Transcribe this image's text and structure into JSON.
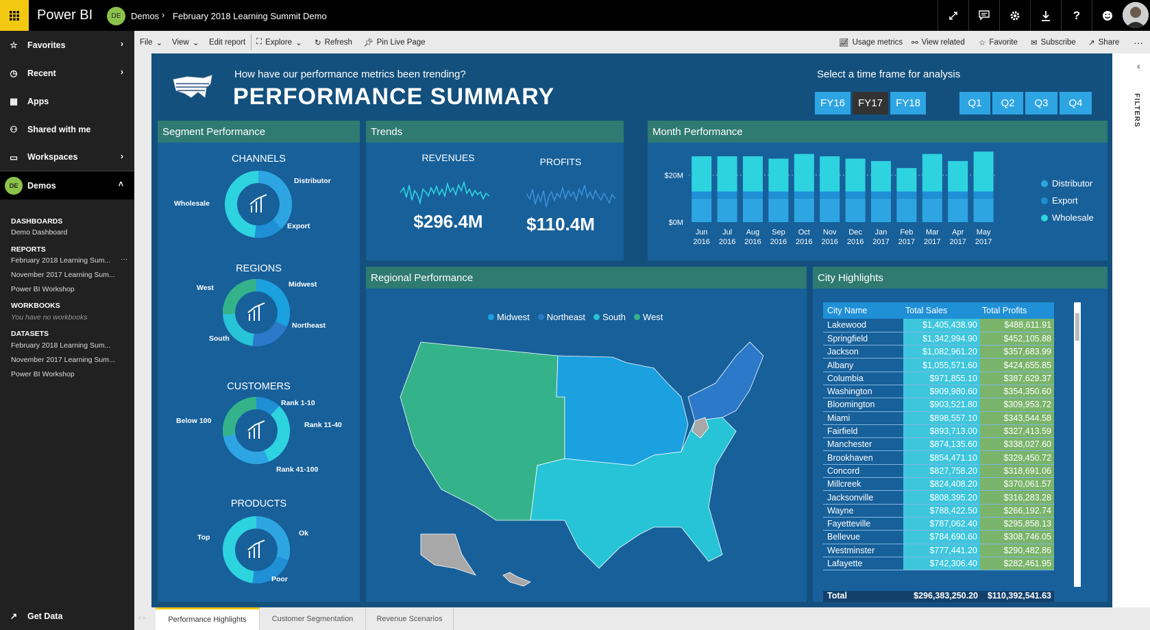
{
  "topbar": {
    "app": "Power BI",
    "avatar": "DE",
    "crumb_workspace": "Demos",
    "crumb_report": "February 2018 Learning Summit Demo"
  },
  "cmdbar": {
    "file": "File",
    "view": "View",
    "edit": "Edit report",
    "explore": "Explore",
    "refresh": "Refresh",
    "pin": "Pin Live Page",
    "usage": "Usage metrics",
    "related": "View related",
    "favorite": "Favorite",
    "subscribe": "Subscribe",
    "share": "Share"
  },
  "sidebar": {
    "favorites": "Favorites",
    "recent": "Recent",
    "apps": "Apps",
    "shared": "Shared with me",
    "workspaces": "Workspaces",
    "demos": "Demos",
    "demos_avatar": "DE",
    "dash_hd": "DASHBOARDS",
    "dash": [
      "Demo Dashboard"
    ],
    "rep_hd": "REPORTS",
    "reports": [
      "February 2018 Learning Sum...",
      "November 2017 Learning Sum...",
      "Power BI Workshop"
    ],
    "wb_hd": "WORKBOOKS",
    "wb_empty": "You have no workbooks",
    "ds_hd": "DATASETS",
    "datasets": [
      "February 2018 Learning Sum...",
      "November 2017 Learning Sum...",
      "Power BI Workshop"
    ],
    "get_data": "Get Data"
  },
  "filters": "FILTERS",
  "report": {
    "subtitle": "How have our performance metrics been trending?",
    "title": "PERFORMANCE SUMMARY",
    "timeframe": "Select a time frame for analysis",
    "years": [
      "FY16",
      "FY17",
      "FY18"
    ],
    "selected_year": "FY17",
    "quarters": [
      "Q1",
      "Q2",
      "Q3",
      "Q4"
    ],
    "colors": {
      "distributor": "#2ea5e3",
      "export": "#1f8fd6",
      "wholesale": "#2ed3e0",
      "midwest": "#1ba0e0",
      "northeast": "#2b79c8",
      "south": "#27c3d6",
      "west": "#34b38a"
    }
  },
  "segment": {
    "title": "Segment Performance",
    "channels": {
      "title": "CHANNELS",
      "labels": [
        "Distributor",
        "Wholesale",
        "Export"
      ]
    },
    "regions": {
      "title": "REGIONS",
      "labels": [
        "West",
        "Midwest",
        "Northeast",
        "South"
      ]
    },
    "customers": {
      "title": "CUSTOMERS",
      "labels": [
        "Rank 1-10",
        "Below 100",
        "Rank 11-40",
        "Rank 41-100"
      ]
    },
    "products": {
      "title": "PRODUCTS",
      "labels": [
        "Top",
        "Ok",
        "Poor"
      ]
    }
  },
  "trends": {
    "title": "Trends",
    "rev_label": "REVENUES",
    "rev_value": "$296.4M",
    "prof_label": "PROFITS",
    "prof_value": "$110.4M"
  },
  "month": {
    "title": "Month Performance",
    "legend": [
      "Distributor",
      "Export",
      "Wholesale"
    ],
    "yticks": [
      "$20M",
      "$0M"
    ]
  },
  "regional": {
    "title": "Regional Performance",
    "legend": [
      "Midwest",
      "Northeast",
      "South",
      "West"
    ]
  },
  "city": {
    "title": "City Highlights",
    "headers": [
      "City Name",
      "Total Sales",
      "Total Profits"
    ],
    "rows": [
      [
        "Lakewood",
        "$1,405,438.90",
        "$488,611.91"
      ],
      [
        "Springfield",
        "$1,342,994.90",
        "$452,105.88"
      ],
      [
        "Jackson",
        "$1,082,961.20",
        "$357,683.99"
      ],
      [
        "Albany",
        "$1,055,571.60",
        "$424,655.85"
      ],
      [
        "Columbia",
        "$971,855.10",
        "$387,629.37"
      ],
      [
        "Washington",
        "$909,980.60",
        "$354,350.60"
      ],
      [
        "Bloomington",
        "$903,521.80",
        "$309,953.72"
      ],
      [
        "Miami",
        "$898,557.10",
        "$343,544.58"
      ],
      [
        "Fairfield",
        "$893,713.00",
        "$327,413.59"
      ],
      [
        "Manchester",
        "$874,135.60",
        "$338,027.60"
      ],
      [
        "Brookhaven",
        "$854,471.10",
        "$329,450.72"
      ],
      [
        "Concord",
        "$827,758.20",
        "$318,691.06"
      ],
      [
        "Millcreek",
        "$824,408.20",
        "$370,061.57"
      ],
      [
        "Jacksonville",
        "$808,395.20",
        "$316,283.28"
      ],
      [
        "Wayne",
        "$788,422.50",
        "$266,192.74"
      ],
      [
        "Fayetteville",
        "$787,062.40",
        "$295,858.13"
      ],
      [
        "Bellevue",
        "$784,690.60",
        "$308,746.05"
      ],
      [
        "Westminster",
        "$777,441.20",
        "$290,482.86"
      ],
      [
        "Lafayette",
        "$742,306.40",
        "$282,461.95"
      ]
    ],
    "total": [
      "Total",
      "$296,383,250.20",
      "$110,392,541.63"
    ]
  },
  "tabs": [
    "Performance Highlights",
    "Customer Segmentation",
    "Revenue Scenarios"
  ],
  "chart_data": {
    "type": "bar",
    "title": "Month Performance",
    "categories": [
      "Jun 2016",
      "Jul 2016",
      "Aug 2016",
      "Sep 2016",
      "Oct 2016",
      "Nov 2016",
      "Dec 2016",
      "Jan 2017",
      "Feb 2017",
      "Mar 2017",
      "Apr 2017",
      "May 2017"
    ],
    "stacked": true,
    "series": [
      {
        "name": "Distributor",
        "values": [
          10,
          10,
          10,
          10,
          10,
          10,
          10,
          10,
          10,
          10,
          10,
          10
        ]
      },
      {
        "name": "Export",
        "values": [
          3,
          3,
          3,
          3,
          3,
          3,
          3,
          3,
          3,
          3,
          3,
          3
        ]
      },
      {
        "name": "Wholesale",
        "values": [
          15,
          15,
          15,
          14,
          16,
          15,
          14,
          13,
          10,
          16,
          13,
          17
        ]
      }
    ],
    "ylim": [
      0,
      28
    ],
    "legend": "right"
  }
}
